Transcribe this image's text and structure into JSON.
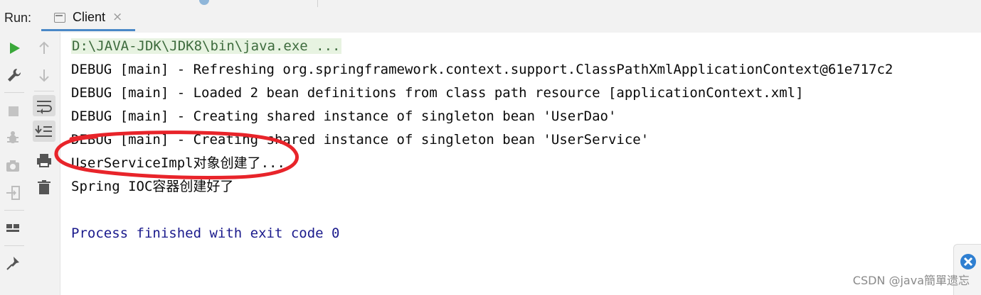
{
  "header": {
    "run_label": "Run:",
    "tab_label": "Client",
    "tab_close": "×"
  },
  "toolbar": {
    "left_icons": [
      "run-icon",
      "wrench-icon",
      "stop-icon",
      "bug-icon",
      "camera-icon",
      "login-icon",
      "layout-icon",
      "pin-icon"
    ],
    "right_icons": [
      "arrow-up-icon",
      "arrow-down-icon",
      "soft-wrap-icon",
      "scroll-to-end-icon",
      "print-icon",
      "trash-icon"
    ]
  },
  "console": {
    "lines": [
      "D:\\JAVA-JDK\\JDK8\\bin\\java.exe ...",
      "DEBUG [main] - Refreshing org.springframework.context.support.ClassPathXmlApplicationContext@61e717c2",
      "DEBUG [main] - Loaded 2 bean definitions from class path resource [applicationContext.xml]",
      "DEBUG [main] - Creating shared instance of singleton bean 'UserDao'",
      "DEBUG [main] - Creating shared instance of singleton bean 'UserService'",
      "UserServiceImpl对象创建了...",
      "Spring IOC容器创建好了",
      "",
      "Process finished with exit code 0"
    ]
  },
  "watermark": "CSDN @java簡單遗忘",
  "colors": {
    "command_bg": "#e7f3e1",
    "command_fg": "#3d6b3d",
    "finish_fg": "#1a1a8c",
    "annotation": "#e8242a",
    "run_green": "#3aa83a"
  }
}
